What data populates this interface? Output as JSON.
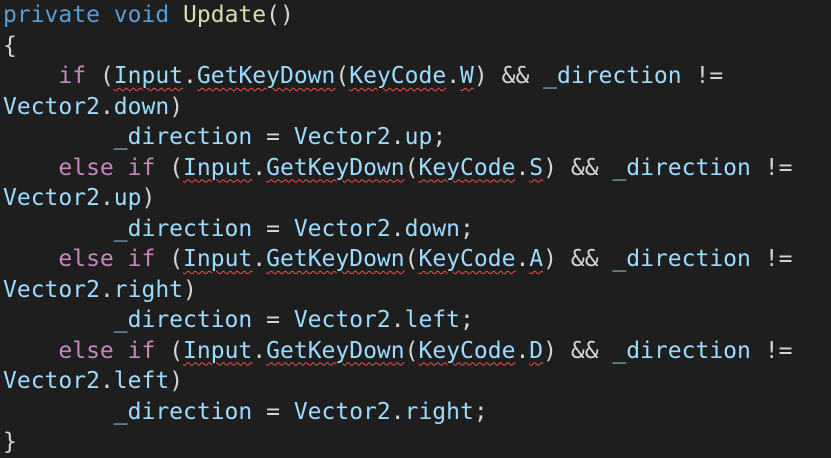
{
  "colors": {
    "background": "#1e1e1e",
    "keyword": "#569cd6",
    "control_keyword": "#c586c0",
    "function": "#dcdcaa",
    "identifier": "#9cdcfe",
    "punctuation": "#d4d4d4",
    "error_squiggle": "#f14c4c"
  },
  "code_lines": [
    [
      {
        "t": "private",
        "k": "kw"
      },
      {
        "t": " ",
        "k": "plain"
      },
      {
        "t": "void",
        "k": "kw"
      },
      {
        "t": " ",
        "k": "plain"
      },
      {
        "t": "Update",
        "k": "fn"
      },
      {
        "t": "()",
        "k": "plain"
      }
    ],
    [
      {
        "t": "{",
        "k": "plain"
      }
    ],
    [
      {
        "t": "    ",
        "k": "plain"
      },
      {
        "t": "if",
        "k": "ctrl"
      },
      {
        "t": " (",
        "k": "plain"
      },
      {
        "t": "Input",
        "k": "var",
        "err": true
      },
      {
        "t": ".",
        "k": "plain"
      },
      {
        "t": "GetKeyDown",
        "k": "var",
        "err": true
      },
      {
        "t": "(",
        "k": "plain"
      },
      {
        "t": "KeyCode",
        "k": "var",
        "err": true
      },
      {
        "t": ".",
        "k": "plain"
      },
      {
        "t": "W",
        "k": "var",
        "err": true
      },
      {
        "t": ") && ",
        "k": "plain"
      },
      {
        "t": "_direction",
        "k": "var"
      },
      {
        "t": " !=",
        "k": "plain"
      }
    ],
    [
      {
        "t": "Vector2",
        "k": "var"
      },
      {
        "t": ".",
        "k": "plain"
      },
      {
        "t": "down",
        "k": "var"
      },
      {
        "t": ")",
        "k": "plain"
      }
    ],
    [
      {
        "t": "        ",
        "k": "plain"
      },
      {
        "t": "_direction",
        "k": "var"
      },
      {
        "t": " = ",
        "k": "plain"
      },
      {
        "t": "Vector2",
        "k": "var"
      },
      {
        "t": ".",
        "k": "plain"
      },
      {
        "t": "up",
        "k": "var"
      },
      {
        "t": ";",
        "k": "plain"
      }
    ],
    [
      {
        "t": "    ",
        "k": "plain"
      },
      {
        "t": "else",
        "k": "ctrl"
      },
      {
        "t": " ",
        "k": "plain"
      },
      {
        "t": "if",
        "k": "ctrl"
      },
      {
        "t": " (",
        "k": "plain"
      },
      {
        "t": "Input",
        "k": "var",
        "err": true
      },
      {
        "t": ".",
        "k": "plain"
      },
      {
        "t": "GetKeyDown",
        "k": "var",
        "err": true
      },
      {
        "t": "(",
        "k": "plain"
      },
      {
        "t": "KeyCode",
        "k": "var",
        "err": true
      },
      {
        "t": ".",
        "k": "plain"
      },
      {
        "t": "S",
        "k": "var",
        "err": true
      },
      {
        "t": ") && ",
        "k": "plain"
      },
      {
        "t": "_direction",
        "k": "var"
      },
      {
        "t": " !=",
        "k": "plain"
      }
    ],
    [
      {
        "t": "Vector2",
        "k": "var"
      },
      {
        "t": ".",
        "k": "plain"
      },
      {
        "t": "up",
        "k": "var"
      },
      {
        "t": ")",
        "k": "plain"
      }
    ],
    [
      {
        "t": "        ",
        "k": "plain"
      },
      {
        "t": "_direction",
        "k": "var"
      },
      {
        "t": " = ",
        "k": "plain"
      },
      {
        "t": "Vector2",
        "k": "var"
      },
      {
        "t": ".",
        "k": "plain"
      },
      {
        "t": "down",
        "k": "var"
      },
      {
        "t": ";",
        "k": "plain"
      }
    ],
    [
      {
        "t": "    ",
        "k": "plain"
      },
      {
        "t": "else",
        "k": "ctrl"
      },
      {
        "t": " ",
        "k": "plain"
      },
      {
        "t": "if",
        "k": "ctrl"
      },
      {
        "t": " (",
        "k": "plain"
      },
      {
        "t": "Input",
        "k": "var",
        "err": true
      },
      {
        "t": ".",
        "k": "plain"
      },
      {
        "t": "GetKeyDown",
        "k": "var",
        "err": true
      },
      {
        "t": "(",
        "k": "plain"
      },
      {
        "t": "KeyCode",
        "k": "var",
        "err": true
      },
      {
        "t": ".",
        "k": "plain"
      },
      {
        "t": "A",
        "k": "var",
        "err": true
      },
      {
        "t": ") && ",
        "k": "plain"
      },
      {
        "t": "_direction",
        "k": "var"
      },
      {
        "t": " !=",
        "k": "plain"
      }
    ],
    [
      {
        "t": "Vector2",
        "k": "var"
      },
      {
        "t": ".",
        "k": "plain"
      },
      {
        "t": "right",
        "k": "var"
      },
      {
        "t": ")",
        "k": "plain"
      }
    ],
    [
      {
        "t": "        ",
        "k": "plain"
      },
      {
        "t": "_direction",
        "k": "var"
      },
      {
        "t": " = ",
        "k": "plain"
      },
      {
        "t": "Vector2",
        "k": "var"
      },
      {
        "t": ".",
        "k": "plain"
      },
      {
        "t": "left",
        "k": "var"
      },
      {
        "t": ";",
        "k": "plain"
      }
    ],
    [
      {
        "t": "    ",
        "k": "plain"
      },
      {
        "t": "else",
        "k": "ctrl"
      },
      {
        "t": " ",
        "k": "plain"
      },
      {
        "t": "if",
        "k": "ctrl"
      },
      {
        "t": " (",
        "k": "plain"
      },
      {
        "t": "Input",
        "k": "var",
        "err": true
      },
      {
        "t": ".",
        "k": "plain"
      },
      {
        "t": "GetKeyDown",
        "k": "var",
        "err": true
      },
      {
        "t": "(",
        "k": "plain"
      },
      {
        "t": "KeyCode",
        "k": "var",
        "err": true
      },
      {
        "t": ".",
        "k": "plain"
      },
      {
        "t": "D",
        "k": "var",
        "err": true
      },
      {
        "t": ") && ",
        "k": "plain"
      },
      {
        "t": "_direction",
        "k": "var"
      },
      {
        "t": " !=",
        "k": "plain"
      }
    ],
    [
      {
        "t": "Vector2",
        "k": "var"
      },
      {
        "t": ".",
        "k": "plain"
      },
      {
        "t": "left",
        "k": "var"
      },
      {
        "t": ")",
        "k": "plain"
      }
    ],
    [
      {
        "t": "        ",
        "k": "plain"
      },
      {
        "t": "_direction",
        "k": "var"
      },
      {
        "t": " = ",
        "k": "plain"
      },
      {
        "t": "Vector2",
        "k": "var"
      },
      {
        "t": ".",
        "k": "plain"
      },
      {
        "t": "right",
        "k": "var"
      },
      {
        "t": ";",
        "k": "plain"
      }
    ],
    [
      {
        "t": "}",
        "k": "plain"
      }
    ]
  ]
}
